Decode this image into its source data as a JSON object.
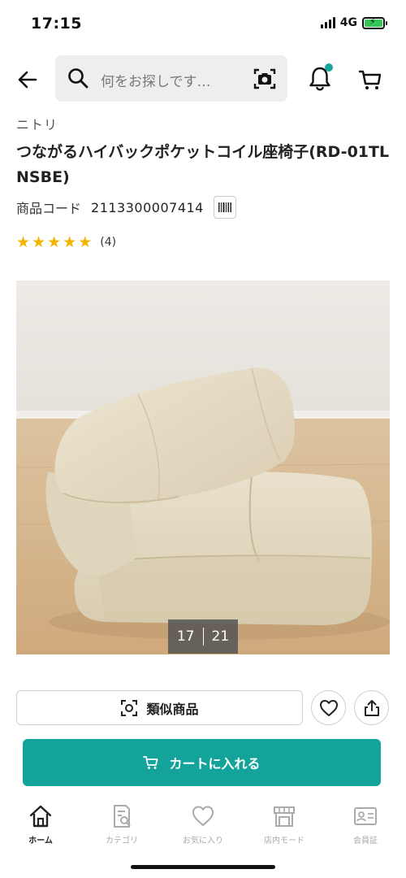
{
  "status_bar": {
    "time": "17:15",
    "network": "4G"
  },
  "header": {
    "search_placeholder": "何をお探しです…",
    "notification_dot_color": "#1aa39a"
  },
  "product": {
    "brand": "ニトリ",
    "title": "つながるハイバックポケットコイル座椅子(RD-01TL NSBE)",
    "code_label": "商品コード",
    "code_value": "2113300007414",
    "rating_stars": 5,
    "review_count": "(4)"
  },
  "gallery": {
    "current": "17",
    "total": "21"
  },
  "actions": {
    "similar_label": "類似商品",
    "add_to_cart_label": "カートに入れる",
    "accent_color": "#14a39a"
  },
  "bottom_nav": {
    "items": [
      {
        "label": "ホーム",
        "icon": "home-icon",
        "active": true
      },
      {
        "label": "カテゴリ",
        "icon": "category-icon",
        "active": false
      },
      {
        "label": "お気に入り",
        "icon": "heart-icon",
        "active": false
      },
      {
        "label": "店内モード",
        "icon": "store-icon",
        "active": false
      },
      {
        "label": "会員証",
        "icon": "member-card-icon",
        "active": false
      }
    ]
  }
}
